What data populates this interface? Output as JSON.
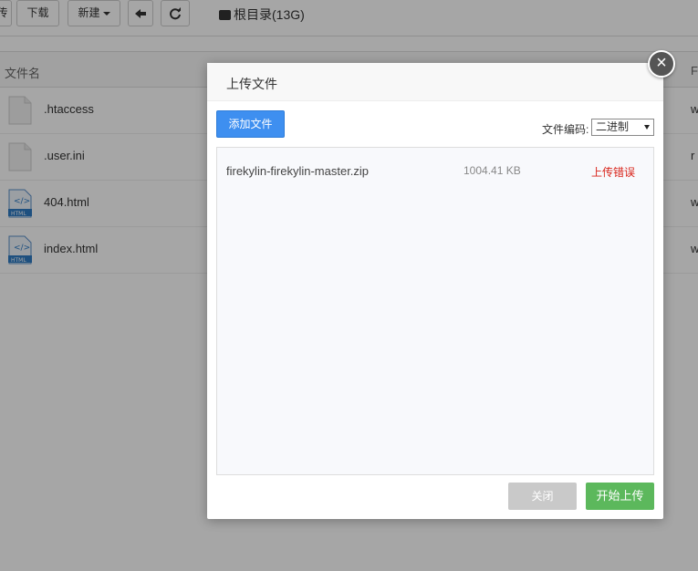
{
  "toolbar": {
    "partial_button_label": "传",
    "download_label": "下载",
    "new_label": "新建",
    "root_path": "根目录(13G)"
  },
  "file_list": {
    "header_name": "文件名",
    "header_right": "F",
    "files": [
      {
        "name": ".htaccess",
        "type": "generic-file",
        "right": "w"
      },
      {
        "name": ".user.ini",
        "type": "generic-file",
        "right": "r"
      },
      {
        "name": "404.html",
        "type": "html-file",
        "right": "w"
      },
      {
        "name": "index.html",
        "type": "html-file",
        "right": "w"
      }
    ]
  },
  "upload_modal": {
    "title": "上传文件",
    "close_icon": "×",
    "add_file_label": "添加文件",
    "encoding_label": "文件编码:",
    "encoding_value": "二进制",
    "items": [
      {
        "name": "firekylin-firekylin-master.zip",
        "size": "1004.41 KB",
        "status": "上传错误"
      }
    ],
    "close_label": "关闭",
    "start_label": "开始上传"
  },
  "colors": {
    "primary": "#3e8ff0",
    "success": "#5cb85c",
    "error": "#d9251b",
    "disabled": "#c9c9c9"
  }
}
